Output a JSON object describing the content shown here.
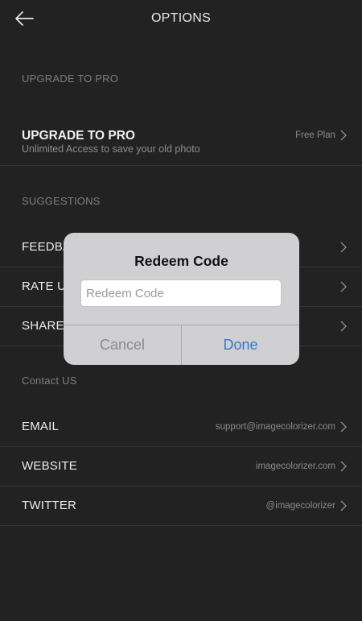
{
  "header": {
    "title": "OPTIONS"
  },
  "sections": {
    "upgrade": "UPGRADE TO PRO",
    "suggestions": "SUGGESTIONS",
    "contact": "Contact US"
  },
  "upgrade_row": {
    "title": "UPGRADE TO PRO",
    "subtitle": "Unlimited Access to save your old photo",
    "value": "Free Plan"
  },
  "suggestion_rows": [
    {
      "label": "FEEDBA"
    },
    {
      "label": "RATE US"
    },
    {
      "label": "SHARE"
    }
  ],
  "contact_rows": [
    {
      "label": "EMAIL",
      "value": "support@imagecolorizer.com"
    },
    {
      "label": "WEBSITE",
      "value": "imagecolorizer.com"
    },
    {
      "label": "TWITTER",
      "value": "@imagecolorizer"
    }
  ],
  "dialog": {
    "title": "Redeem Code",
    "placeholder": "Redeem Code",
    "cancel": "Cancel",
    "done": "Done"
  },
  "colors": {
    "background": "#222223",
    "dialog": "#d0d0d2",
    "accent": "#2f7ad0"
  },
  "icons": [
    "back-arrow-icon",
    "chevron-right-icon"
  ]
}
